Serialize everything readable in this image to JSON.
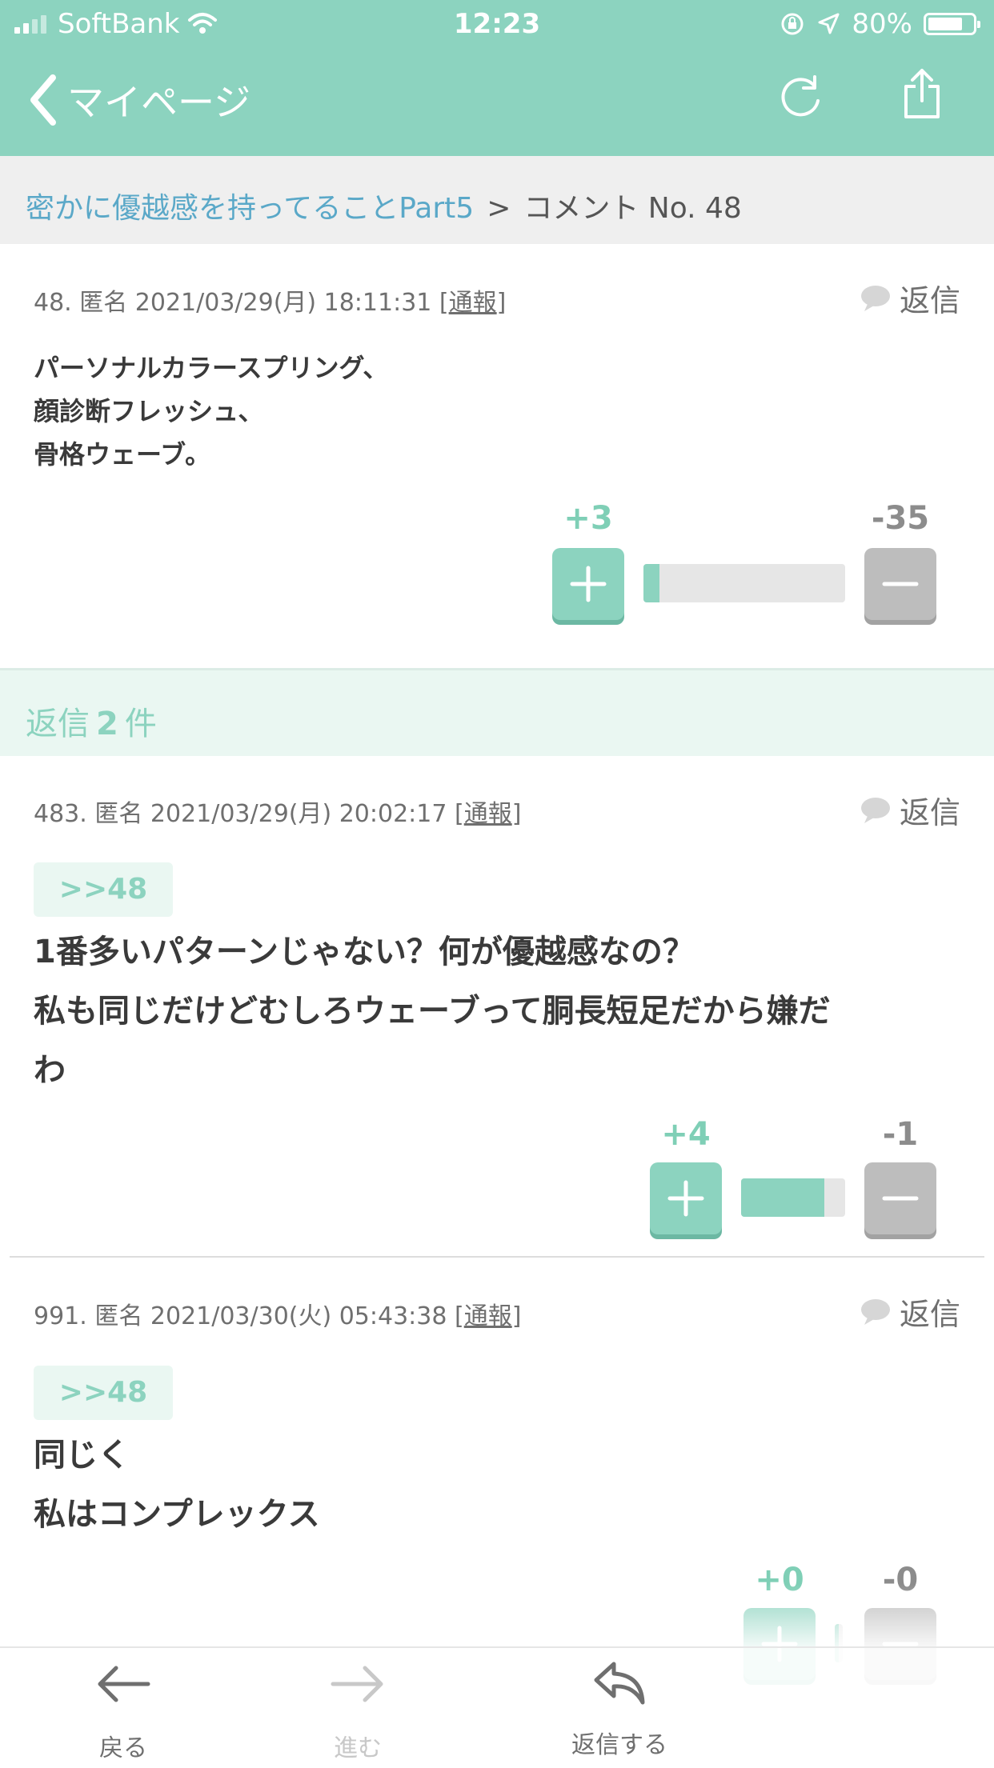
{
  "status": {
    "carrier": "SoftBank",
    "time": "12:23",
    "battery": "80%",
    "battery_level": 0.8
  },
  "nav": {
    "back_label": "マイページ"
  },
  "breadcrumb": {
    "topic": "密かに優越感を持ってることPart5",
    "separator": ">",
    "current": "コメント No. 48"
  },
  "main_comment": {
    "meta": "48. 匿名 2021/03/29(月) 18:11:31 [",
    "report": "通報",
    "meta_end": "]",
    "reply_label": "返信",
    "lines": [
      "パーソナルカラースプリング、",
      "顔診断フレッシュ、",
      "骨格ウェーブ。"
    ],
    "plus": "+3",
    "minus": "-35",
    "plus_ratio": 0.08
  },
  "replies_header": {
    "prefix": "返信",
    "count": "2",
    "suffix": "件"
  },
  "replies": [
    {
      "meta": "483. 匿名 2021/03/29(月) 20:02:17 [",
      "report": "通報",
      "meta_end": "]",
      "reply_label": "返信",
      "quote": ">>48",
      "lines": [
        "1番多いパターンじゃない？何が優越感なの？",
        "私も同じだけどむしろウェーブって胴長短足だから嫌だ",
        "わ"
      ],
      "plus": "+4",
      "minus": "-1",
      "plus_ratio": 0.8
    },
    {
      "meta": "991. 匿名 2021/03/30(火) 05:43:38 [",
      "report": "通報",
      "meta_end": "]",
      "reply_label": "返信",
      "quote": ">>48",
      "lines": [
        "同じく",
        "私はコンプレックス"
      ],
      "plus": "+0",
      "minus": "-0",
      "plus_ratio": 0.5
    }
  ],
  "bottom_bar": {
    "back": "戻る",
    "forward": "進む",
    "reply": "返信する"
  },
  "colors": {
    "accent": "#8cd3bf",
    "link": "#5aa8c8",
    "minus": "#bdbdbd"
  }
}
